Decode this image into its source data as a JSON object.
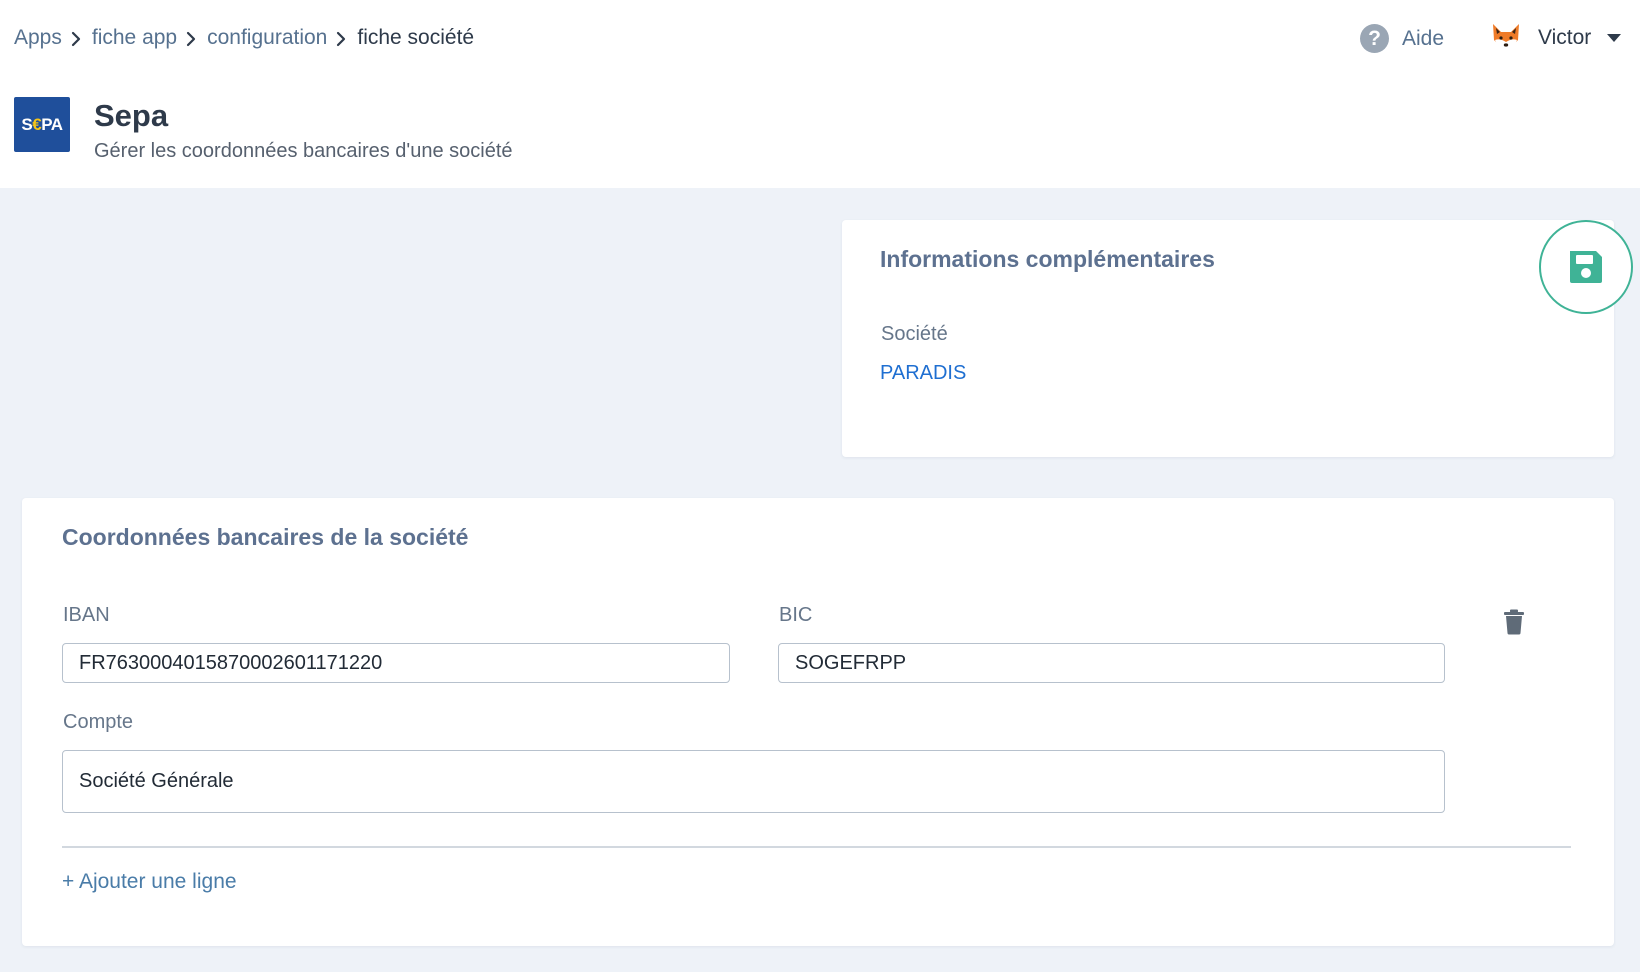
{
  "breadcrumb": {
    "items": [
      "Apps",
      "fiche app",
      "configuration"
    ],
    "current": "fiche société"
  },
  "header": {
    "help_label": "Aide",
    "user_name": "Victor"
  },
  "app": {
    "logo_text_s": "S",
    "logo_text_euro": "€",
    "logo_text_pa": "PA",
    "title": "Sepa",
    "subtitle": "Gérer les coordonnées bancaires d'une société"
  },
  "info_card": {
    "title": "Informations complémentaires",
    "company_label": "Société",
    "company_value": "PARADIS"
  },
  "bank_card": {
    "title": "Coordonnées bancaires de la société",
    "iban_label": "IBAN",
    "iban_value": "FR7630004015870002601171220",
    "bic_label": "BIC",
    "bic_value": "SOGEFRPP",
    "account_label": "Compte",
    "account_value": "Société Générale",
    "add_line_label": "+ Ajouter une ligne"
  },
  "colors": {
    "accent_green": "#3fb396",
    "link_blue": "#1f6fd1",
    "logo_blue": "#1f4f9b",
    "background": "#eef2f8"
  },
  "icons": [
    "chevron-right-icon",
    "help-icon",
    "fox-avatar",
    "caret-down-icon",
    "save-icon",
    "trash-icon"
  ]
}
